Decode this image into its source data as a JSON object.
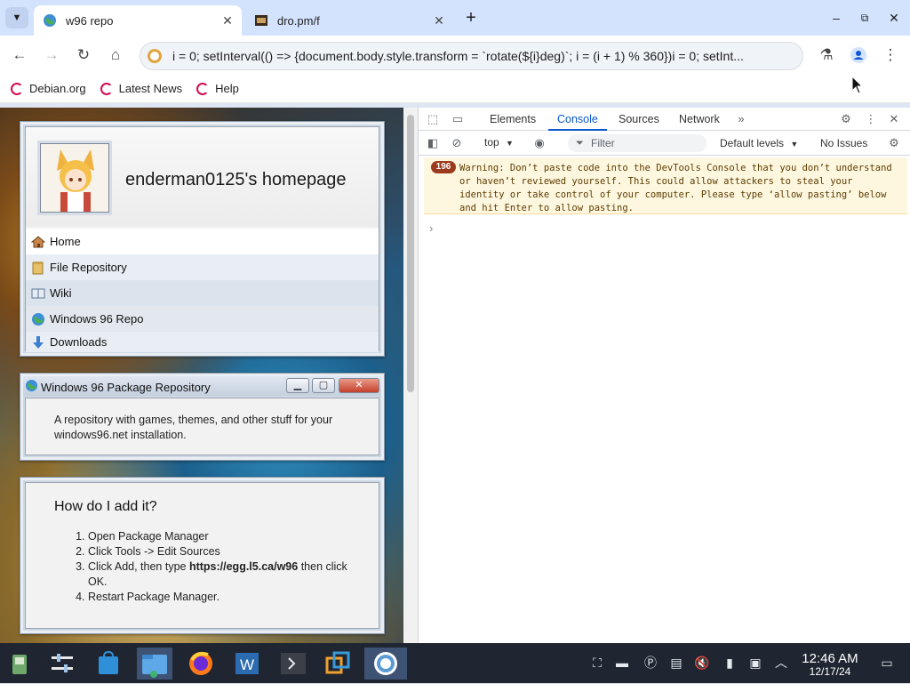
{
  "browser": {
    "tabs": [
      {
        "title": "w96 repo",
        "active": true,
        "icon": "globe-icon"
      },
      {
        "title": "dro.pm/f",
        "active": false,
        "icon": "film-icon"
      }
    ],
    "address": "i = 0; setInterval(() => {document.body.style.transform = `rotate(${i}deg)`; i = (i + 1) % 360})i = 0; setInt...",
    "bookmarks": [
      "Debian.org",
      "Latest News",
      "Help"
    ]
  },
  "page": {
    "site_title": "enderman0125's homepage",
    "nav": [
      "Home",
      "File Repository",
      "Wiki",
      "Windows 96 Repo",
      "Downloads"
    ],
    "repo_window": {
      "title": "Windows 96 Package Repository",
      "description": "A repository with games, themes, and other stuff for your windows96.net installation."
    },
    "howto": {
      "heading": "How do I add it?",
      "steps": {
        "s1": "Open Package Manager",
        "s2": "Click Tools -> Edit Sources",
        "s3_pre": "Click Add, then type ",
        "s3_url": "https://egg.l5.ca/w96",
        "s3_post": " then click OK.",
        "s4": "Restart Package Manager."
      }
    }
  },
  "devtools": {
    "tabs": [
      "Elements",
      "Console",
      "Sources",
      "Network"
    ],
    "active_tab": "Console",
    "context": "top",
    "filter_placeholder": "Filter",
    "levels": "Default levels",
    "issues": "No Issues",
    "warning_count": "196",
    "warning": "Warning: Don’t paste code into the DevTools Console that you don’t understand or haven’t reviewed yourself. This could allow attackers to steal your identity or take control of your computer. Please type ‘allow pasting’ below and hit Enter to allow pasting.",
    "prompt": "›"
  },
  "taskbar": {
    "time": "12:46 AM",
    "date": "12/17/24"
  },
  "colors": {
    "accent": "#0b57d0",
    "warning_bg": "#fef7e0",
    "taskbar": "#1f2631"
  }
}
